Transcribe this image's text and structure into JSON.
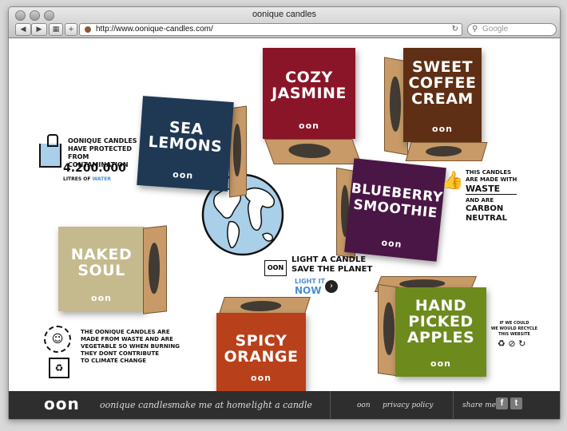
{
  "window": {
    "title": "oonique candles"
  },
  "browser": {
    "url": "http://www.oonique-candles.com/",
    "search_placeholder": "Google",
    "back_icon": "back-arrow-icon",
    "forward_icon": "forward-arrow-icon"
  },
  "products": [
    {
      "name": "SEA\nLEMONS",
      "logo": "oon",
      "color": "#1f3854"
    },
    {
      "name": "COZY\nJASMINE",
      "logo": "oon",
      "color": "#8a1428"
    },
    {
      "name": "SWEET\nCOFFEE\nCREAM",
      "logo": "oon",
      "color": "#5e2f14"
    },
    {
      "name": "BLUEBERRY\nSMOOTHIE",
      "logo": "oon",
      "color": "#4a1645"
    },
    {
      "name": "NAKED\nSOUL",
      "logo": "oon",
      "color": "#c5b98e"
    },
    {
      "name": "SPICY\nORANGE",
      "logo": "oon",
      "color": "#b8401a"
    },
    {
      "name": "HAND\nPICKED\nAPPLES",
      "logo": "oon",
      "color": "#6d8a1d"
    }
  ],
  "water": {
    "line1": "OONIQUE CANDLES",
    "line2": "HAVE PROTECTED",
    "line3": "FROM CONTAMINATION",
    "amount": "4.200.000",
    "unit_prefix": "LITRES OF",
    "unit_word": "WATER"
  },
  "waste": {
    "line1": "THIS CANDLES",
    "line2": "ARE MADE WITH",
    "big1": "WASTE",
    "line3": "AND ARE",
    "big2": "CARBON",
    "big3": "NEUTRAL"
  },
  "cta": {
    "badge": "OON",
    "line1": "LIGHT A CANDLE",
    "line2": "SAVE THE PLANET",
    "link1": "LIGHT IT",
    "link2": "NOW"
  },
  "vegetable": {
    "line1": "THE OONIQUE CANDLES ARE",
    "line2": "MADE FROM WASTE AND ARE",
    "line3": "VEGETABLE SO WHEN BURNING",
    "line4": "THEY DONT CONTRIBUTE",
    "line5": "TO CLIMATE CHANGE"
  },
  "recycle": {
    "line1": "IF WE COULD",
    "line2": "WE WOULD RECYCLE",
    "line3": "THIS WEBSITE"
  },
  "footer": {
    "logo": "oon",
    "nav": [
      "oonique candles",
      "make me at home",
      "light a candle"
    ],
    "links": [
      "oon",
      "privacy policy"
    ],
    "share_label": "share me",
    "facebook": "f",
    "twitter": "t"
  }
}
